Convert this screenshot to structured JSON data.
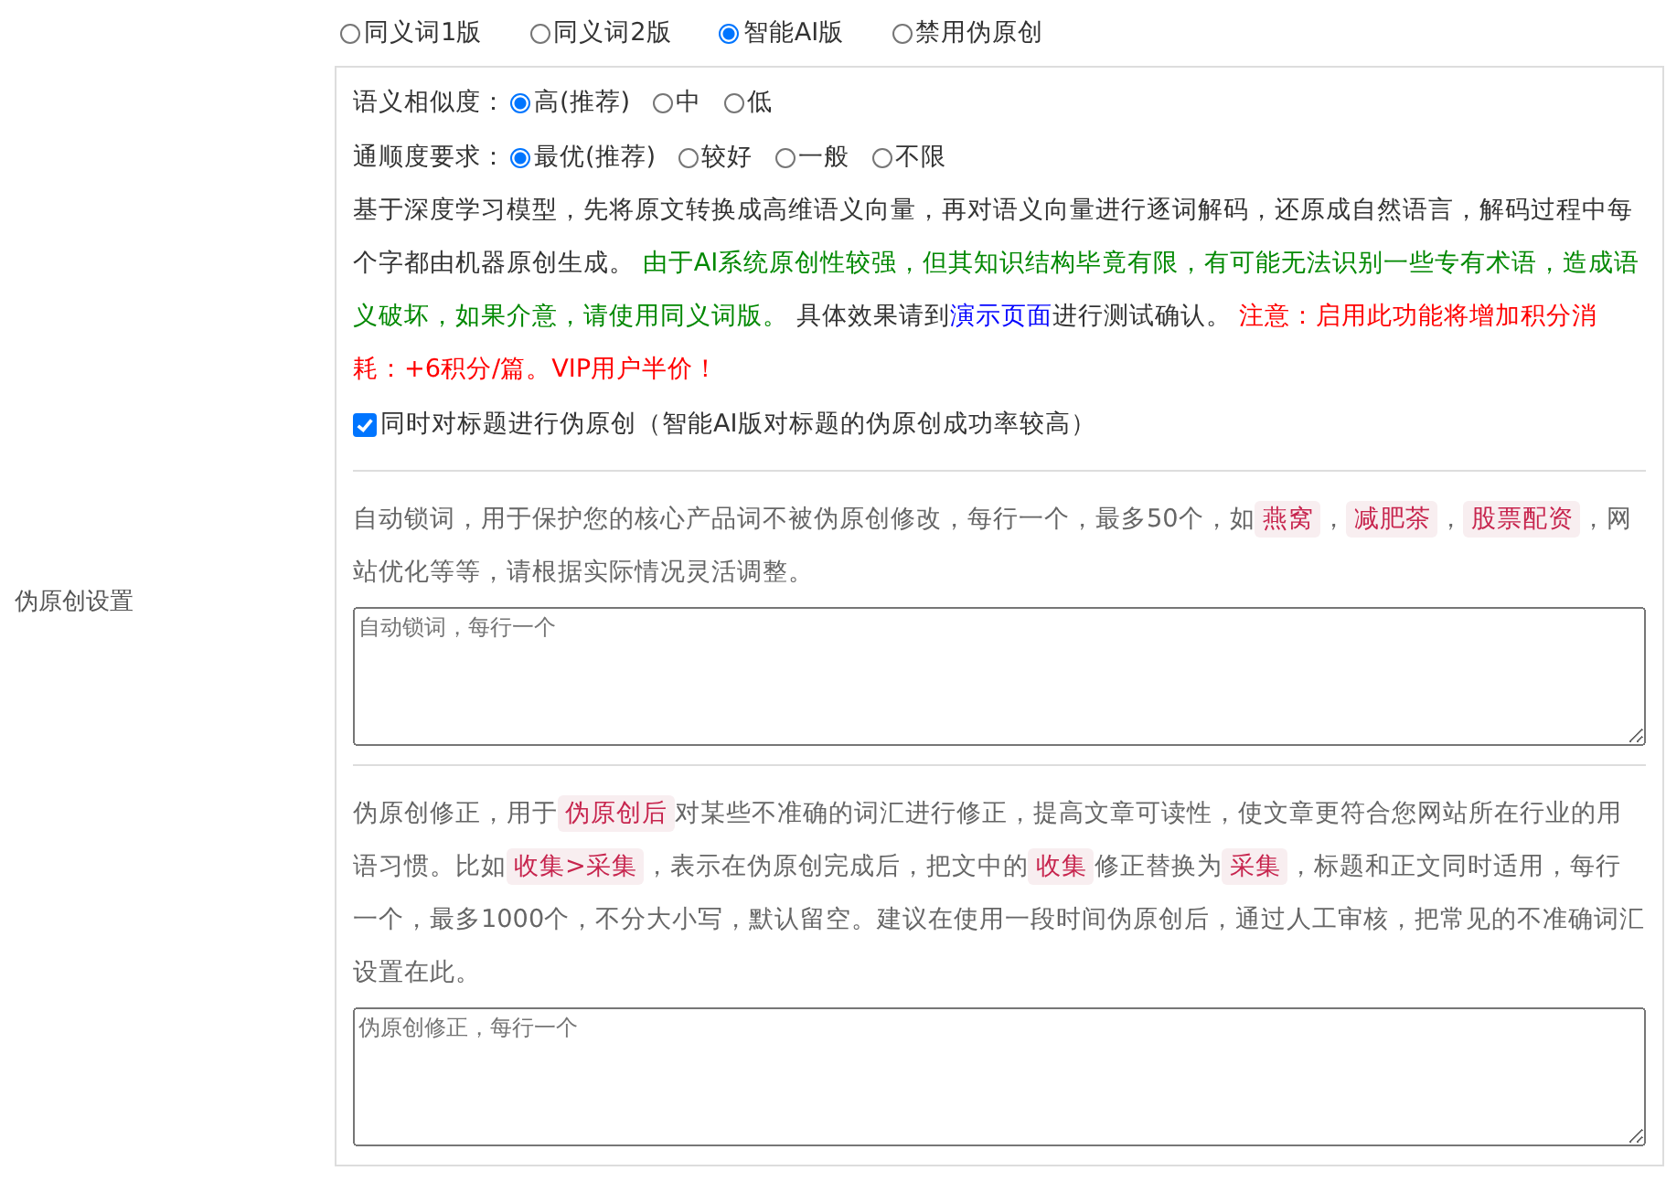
{
  "version_options": [
    {
      "label": "同义词1版",
      "selected": false
    },
    {
      "label": "同义词2版",
      "selected": false
    },
    {
      "label": "智能AI版",
      "selected": true
    },
    {
      "label": "禁用伪原创",
      "selected": false
    }
  ],
  "ai_settings": [
    {
      "label": "语义相似度：",
      "options": [
        {
          "label": "高(推荐)",
          "selected": true
        },
        {
          "label": "中",
          "selected": false
        },
        {
          "label": "低",
          "selected": false
        }
      ]
    },
    {
      "label": "通顺度要求：",
      "options": [
        {
          "label": "最优(推荐)",
          "selected": true
        },
        {
          "label": "较好",
          "selected": false
        },
        {
          "label": "一般",
          "selected": false
        },
        {
          "label": "不限",
          "selected": false
        }
      ]
    }
  ],
  "ai_description": [
    {
      "kind": "text",
      "text": "基于深度学习模型，先将原文转换成高维语义向量，再对语义向量进行逐词解码，还原成自然语言，解码过程中每个字都由机器原创生成。 "
    },
    {
      "kind": "note",
      "text": "由于AI系统原创性较强，但其知识结构毕竟有限，有可能无法识别一些专有术语，造成语义破坏，如果介意，请使用同义词版。"
    },
    {
      "kind": "text",
      "text": " 具体效果请到"
    },
    {
      "kind": "link",
      "text": "演示页面"
    },
    {
      "kind": "text",
      "text": "进行测试确认。 "
    },
    {
      "kind": "warning",
      "text": "注意：启用此功能将增加积分消耗：+6积分/篇。VIP用户半价！"
    }
  ],
  "title_option": {
    "label": "同时对标题进行伪原创（智能AI版对标题的伪原创成功率较高）",
    "checked": true
  },
  "side_label": "伪原创设置",
  "sections": [
    {
      "description": [
        {
          "kind": "text",
          "text": "自动锁词，用于保护您的核心产品词不被伪原创修改，每行一个，最多50个，如"
        },
        {
          "kind": "tag",
          "text": "燕窝"
        },
        {
          "kind": "text",
          "text": "，"
        },
        {
          "kind": "tag",
          "text": "减肥茶"
        },
        {
          "kind": "text",
          "text": "，"
        },
        {
          "kind": "tag",
          "text": "股票配资"
        },
        {
          "kind": "text",
          "text": "，网站优化等等，请根据实际情况灵活调整。"
        }
      ],
      "placeholder": "自动锁词，每行一个"
    },
    {
      "description": [
        {
          "kind": "text",
          "text": "伪原创修正，用于"
        },
        {
          "kind": "tag",
          "text": "伪原创后"
        },
        {
          "kind": "text",
          "text": "对某些不准确的词汇进行修正，提高文章可读性，使文章更符合您网站所在行业的用语习惯。比如"
        },
        {
          "kind": "tag",
          "text": "收集>采集"
        },
        {
          "kind": "text",
          "text": "，表示在伪原创完成后，把文中的"
        },
        {
          "kind": "tag",
          "text": "收集"
        },
        {
          "kind": "text",
          "text": "修正替换为"
        },
        {
          "kind": "tag",
          "text": "采集"
        },
        {
          "kind": "text",
          "text": "，标题和正文同时适用，每行一个，最多1000个，不分大小写，默认留空。建议在使用一段时间伪原创后，通过人工审核，把常见的不准确词汇设置在此。"
        }
      ],
      "placeholder": "伪原创修正，每行一个"
    }
  ]
}
